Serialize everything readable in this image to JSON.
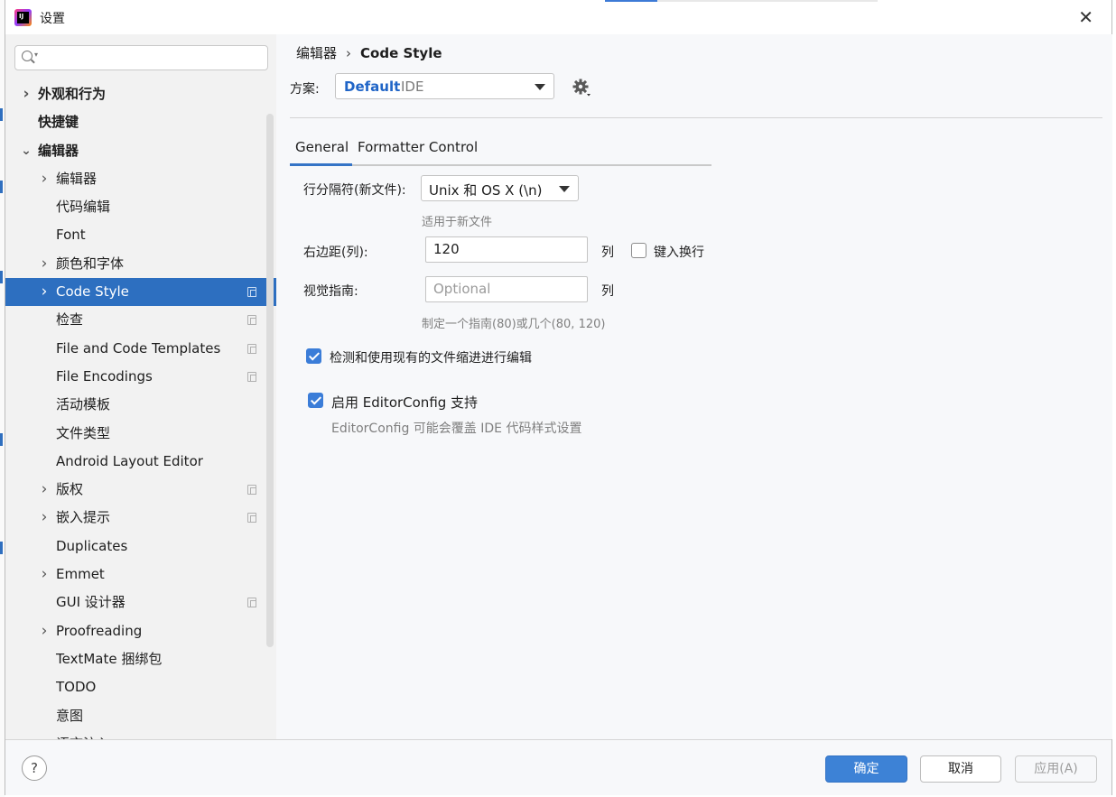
{
  "window": {
    "title": "设置",
    "close_icon": "close-icon"
  },
  "search": {
    "placeholder": ""
  },
  "sidebar": {
    "items": [
      {
        "label": "外观和行为",
        "bold": true,
        "chevron": "right",
        "level": 0,
        "copy": false
      },
      {
        "label": "快捷键",
        "bold": true,
        "chevron": "",
        "level": 0,
        "copy": false
      },
      {
        "label": "编辑器",
        "bold": true,
        "chevron": "down",
        "level": 0,
        "copy": false
      },
      {
        "label": "编辑器",
        "bold": false,
        "chevron": "right",
        "level": 1,
        "copy": false
      },
      {
        "label": "代码编辑",
        "bold": false,
        "chevron": "",
        "level": 1,
        "copy": false
      },
      {
        "label": "Font",
        "bold": false,
        "chevron": "",
        "level": 1,
        "copy": false
      },
      {
        "label": "颜色和字体",
        "bold": false,
        "chevron": "right",
        "level": 1,
        "copy": false
      },
      {
        "label": "Code Style",
        "bold": false,
        "chevron": "right",
        "level": 1,
        "copy": true,
        "selected": true
      },
      {
        "label": "检查",
        "bold": false,
        "chevron": "",
        "level": 1,
        "copy": true
      },
      {
        "label": "File and Code Templates",
        "bold": false,
        "chevron": "",
        "level": 1,
        "copy": true
      },
      {
        "label": "File Encodings",
        "bold": false,
        "chevron": "",
        "level": 1,
        "copy": true
      },
      {
        "label": "活动模板",
        "bold": false,
        "chevron": "",
        "level": 1,
        "copy": false
      },
      {
        "label": "文件类型",
        "bold": false,
        "chevron": "",
        "level": 1,
        "copy": false
      },
      {
        "label": "Android Layout Editor",
        "bold": false,
        "chevron": "",
        "level": 1,
        "copy": false
      },
      {
        "label": "版权",
        "bold": false,
        "chevron": "right",
        "level": 1,
        "copy": true
      },
      {
        "label": "嵌入提示",
        "bold": false,
        "chevron": "right",
        "level": 1,
        "copy": true
      },
      {
        "label": "Duplicates",
        "bold": false,
        "chevron": "",
        "level": 1,
        "copy": false
      },
      {
        "label": "Emmet",
        "bold": false,
        "chevron": "right",
        "level": 1,
        "copy": false
      },
      {
        "label": "GUI 设计器",
        "bold": false,
        "chevron": "",
        "level": 1,
        "copy": true
      },
      {
        "label": "Proofreading",
        "bold": false,
        "chevron": "right",
        "level": 1,
        "copy": false
      },
      {
        "label": "TextMate 捆绑包",
        "bold": false,
        "chevron": "",
        "level": 1,
        "copy": false
      },
      {
        "label": "TODO",
        "bold": false,
        "chevron": "",
        "level": 1,
        "copy": false
      },
      {
        "label": "意图",
        "bold": false,
        "chevron": "",
        "level": 1,
        "copy": false
      },
      {
        "label": "语言注入",
        "bold": false,
        "chevron": "right",
        "level": 1,
        "copy": true
      }
    ]
  },
  "breadcrumb": {
    "parent": "编辑器",
    "current": "Code Style"
  },
  "scheme": {
    "label": "方案:",
    "value": "Default",
    "sub": "IDE"
  },
  "tabs": [
    {
      "label": "General",
      "active": true
    },
    {
      "label": "Formatter Control",
      "active": false
    }
  ],
  "general": {
    "line_sep_label": "行分隔符(新文件):",
    "line_sep_value": "Unix 和 OS X (\\n)",
    "line_sep_hint": "适用于新文件",
    "margin_label": "右边距(列):",
    "margin_value": "120",
    "margin_unit": "列",
    "wrap_label": "键入换行",
    "wrap_checked": false,
    "guides_label": "视觉指南:",
    "guides_placeholder": "Optional",
    "guides_unit": "列",
    "guides_hint": "制定一个指南(80)或几个(80, 120)",
    "detect_indent_label": "检测和使用现有的文件缩进进行编辑",
    "detect_indent_checked": true,
    "editorconfig_label": "启用 EditorConfig 支持",
    "editorconfig_checked": true,
    "editorconfig_hint": "EditorConfig 可能会覆盖 IDE 代码样式设置"
  },
  "footer": {
    "ok": "确定",
    "cancel": "取消",
    "apply": "应用(A)",
    "help": "?"
  },
  "colors": {
    "selected": "#2d6fc0",
    "accent": "#3d82d6",
    "link": "#2065c7"
  }
}
